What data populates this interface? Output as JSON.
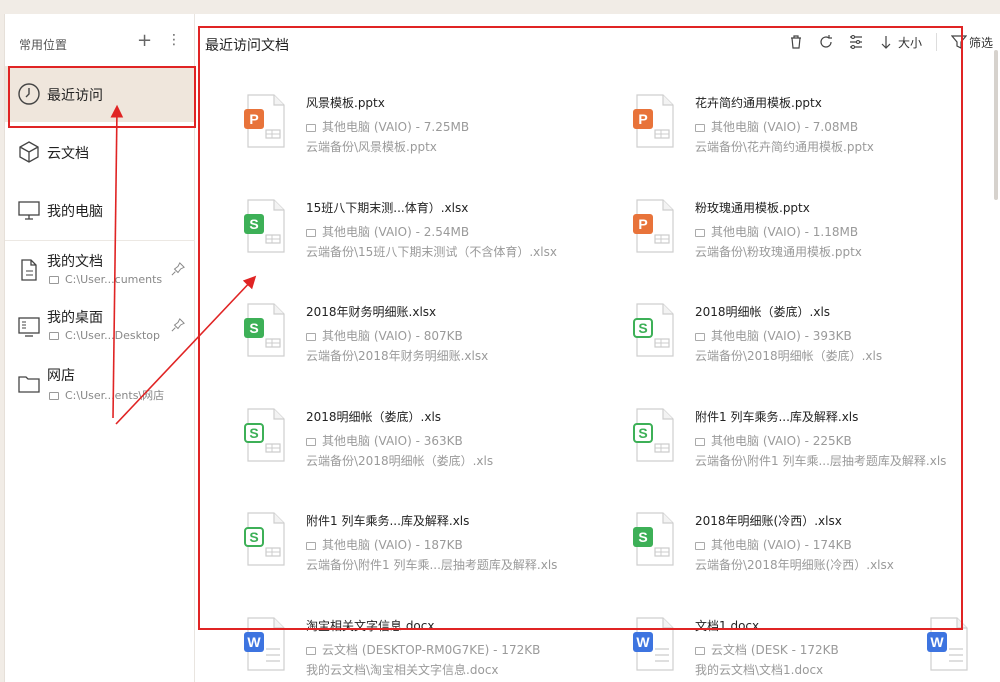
{
  "sidebar": {
    "header": "常用位置",
    "add_icon": "plus-icon",
    "more_icon": "more-icon",
    "items": [
      {
        "label": "最近访问",
        "icon": "clock-icon"
      },
      {
        "label": "云文档",
        "icon": "cloud-box-icon"
      },
      {
        "label": "我的电脑",
        "icon": "monitor-icon"
      },
      {
        "label": "我的文档",
        "sub": "C:\\User...cuments",
        "icon": "document-icon"
      },
      {
        "label": "我的桌面",
        "sub": "C:\\User...Desktop",
        "icon": "desktop-icon"
      },
      {
        "label": "网店",
        "sub": "C:\\User...ents\\网店",
        "icon": "folder-icon"
      }
    ]
  },
  "main": {
    "title": "最近访问文档",
    "toolbar": {
      "sort_label": "大小",
      "filter_label": "筛选"
    },
    "files": [
      {
        "name": "风景模板.pptx",
        "meta": "其他电脑 (VAIO)   - 7.25MB",
        "path": "云端备份\\风景模板.pptx",
        "type": "ppt"
      },
      {
        "name": "花卉简约通用模板.pptx",
        "meta": "其他电脑 (VAIO)   - 7.08MB",
        "path": "云端备份\\花卉简约通用模板.pptx",
        "type": "ppt"
      },
      {
        "name": "15班八下期末测...体育）.xlsx",
        "meta": "其他电脑 (VAIO)   - 2.54MB",
        "path": "云端备份\\15班八下期末测试（不含体育）.xlsx",
        "type": "xls"
      },
      {
        "name": "粉玫瑰通用模板.pptx",
        "meta": "其他电脑 (VAIO)   - 1.18MB",
        "path": "云端备份\\粉玫瑰通用模板.pptx",
        "type": "ppt"
      },
      {
        "name": "2018年财务明细账.xlsx",
        "meta": "其他电脑 (VAIO)   - 807KB",
        "path": "云端备份\\2018年财务明细账.xlsx",
        "type": "xls"
      },
      {
        "name": "2018明细帐（娄底）.xls",
        "meta": "其他电脑 (VAIO)   - 393KB",
        "path": "云端备份\\2018明细帐（娄底）.xls",
        "type": "xls-o"
      },
      {
        "name": "2018明细帐（娄底）.xls",
        "meta": "其他电脑 (VAIO)   - 363KB",
        "path": "云端备份\\2018明细帐（娄底）.xls",
        "type": "xls-o"
      },
      {
        "name": "附件1 列车乘务...库及解释.xls",
        "meta": "其他电脑 (VAIO)   - 225KB",
        "path": "云端备份\\附件1 列车乘...层抽考题库及解释.xls",
        "type": "xls-o"
      },
      {
        "name": "附件1 列车乘务...库及解释.xls",
        "meta": "其他电脑 (VAIO)   - 187KB",
        "path": "云端备份\\附件1 列车乘...层抽考题库及解释.xls",
        "type": "xls-o"
      },
      {
        "name": "2018年明细账(冷西）.xlsx",
        "meta": "其他电脑 (VAIO)   - 174KB",
        "path": "云端备份\\2018年明细账(冷西）.xlsx",
        "type": "xls"
      },
      {
        "name": "淘宝相关文字信息.docx",
        "meta": "云文档 (DESKTOP-RM0G7KE)   - 172KB",
        "path": "我的云文档\\淘宝相关文字信息.docx",
        "type": "doc"
      },
      {
        "name": "文档1.docx",
        "meta": "云文档 (DESK   - 172KB",
        "path": "我的云文档\\文档1.docx",
        "type": "doc"
      }
    ]
  },
  "colors": {
    "ppt": "#e8733a",
    "xls": "#3db057",
    "doc": "#3d74e0",
    "accent": "#e02424"
  }
}
